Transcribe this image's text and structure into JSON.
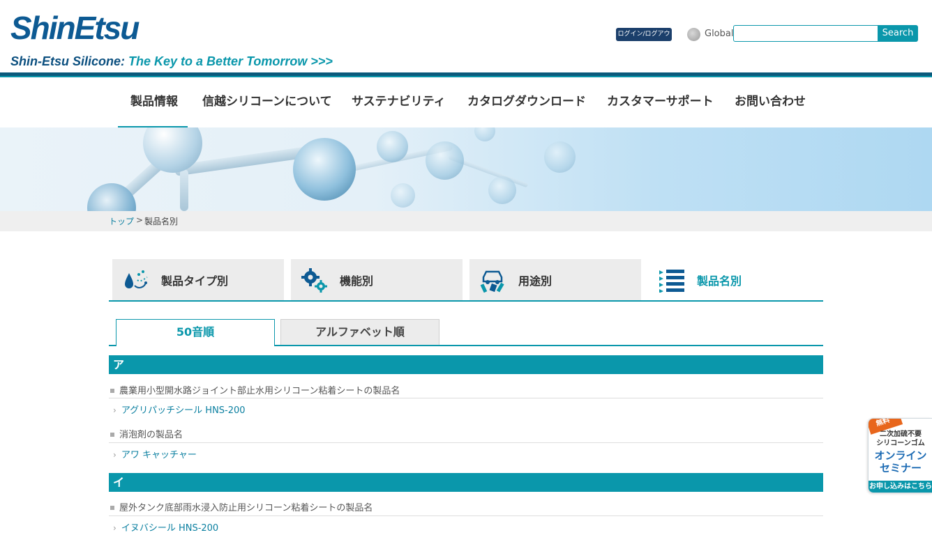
{
  "header": {
    "logo_text": "ShinEtsu",
    "tagline_brand": "Shin-Etsu Silicone:",
    "tagline_slogan": "The Key to a Better Tomorrow >>>",
    "login_label": "ログイン/ログアウト",
    "global_label": "Global",
    "search_value": "",
    "search_button": "Search"
  },
  "nav": {
    "items": [
      {
        "label": "製品情報"
      },
      {
        "label": "信越シリコーンについて"
      },
      {
        "label": "サステナビリティ"
      },
      {
        "label": "カタログダウンロード"
      },
      {
        "label": "カスタマーサポート"
      },
      {
        "label": "お問い合わせ"
      }
    ]
  },
  "breadcrumb": {
    "home": "トップ",
    "separator": ">",
    "current": "製品名別"
  },
  "category_tabs": [
    {
      "label": "製品タイプ別",
      "icon": "droplets-icon"
    },
    {
      "label": "機能別",
      "icon": "gears-icon"
    },
    {
      "label": "用途別",
      "icon": "car-tools-icon"
    },
    {
      "label": "製品名別",
      "icon": "list-icon",
      "active": true
    }
  ],
  "sort_tabs": {
    "active": "50音順",
    "inactive": "アルファベット順"
  },
  "sections": [
    {
      "heading": "ア",
      "groups": [
        {
          "category": "農業用小型開水路ジョイント部止水用シリコーン粘着シートの製品名",
          "product": "アグリパッチシール HNS-200"
        },
        {
          "category": "消泡剤の製品名",
          "product": "アワ キャッチャー"
        }
      ]
    },
    {
      "heading": "イ",
      "groups": [
        {
          "category": "屋外タンク底部雨水浸入防止用シリコーン粘着シートの製品名",
          "product": "イヌバシール HNS-200"
        }
      ]
    }
  ],
  "seminar": {
    "free_label": "無料",
    "top_text_1": "二次加硫不要",
    "top_text_2": "シリコーンゴム",
    "title_1": "オンライン",
    "title_2": "セミナー",
    "footer": "お申し込みはこちら"
  },
  "colors": {
    "accent": "#0a97ab",
    "brand": "#0d5a93"
  }
}
